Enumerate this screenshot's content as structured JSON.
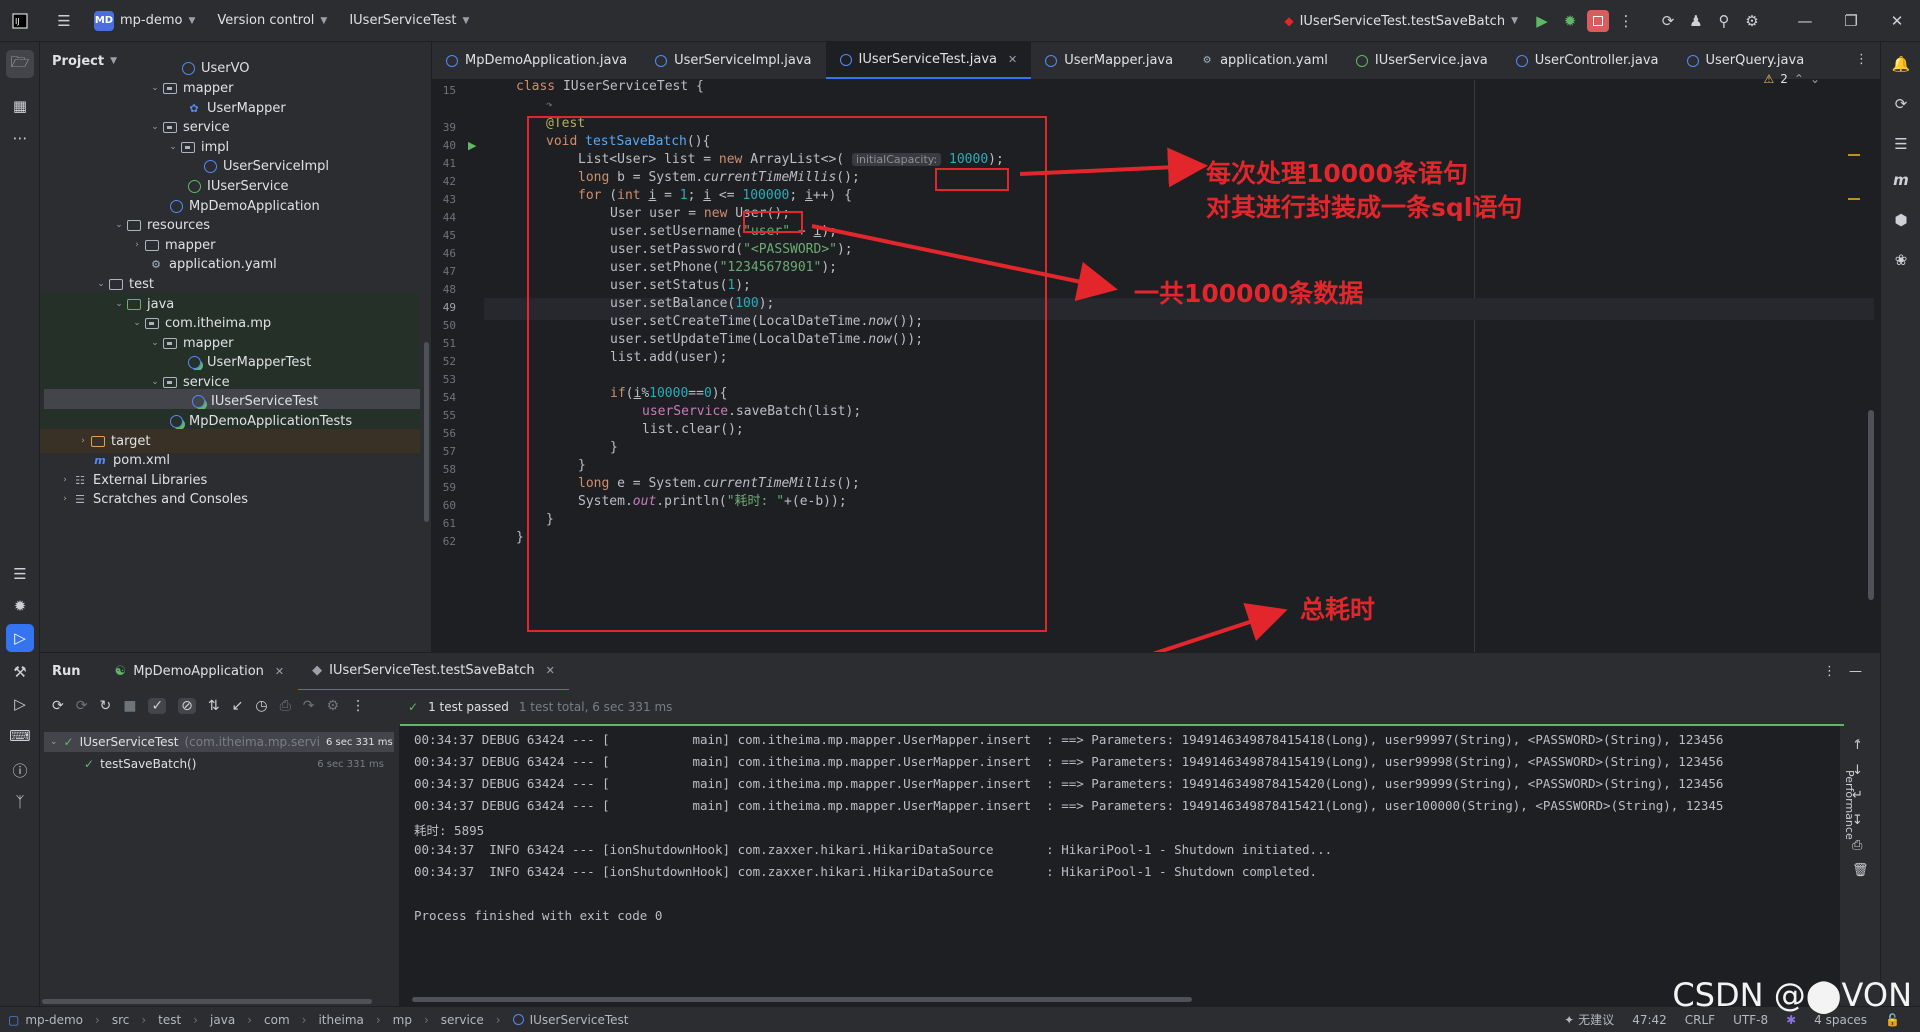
{
  "titlebar": {
    "project_badge": "MD",
    "project_name": "mp-demo",
    "vcs": "Version control",
    "file": "IUserServiceTest",
    "run_config": "IUserServiceTest.testSaveBatch"
  },
  "project_panel": {
    "title": "Project",
    "items": [
      {
        "label": "UserVO"
      },
      {
        "label": "mapper"
      },
      {
        "label": "UserMapper"
      },
      {
        "label": "service"
      },
      {
        "label": "impl"
      },
      {
        "label": "UserServiceImpl"
      },
      {
        "label": "IUserService"
      },
      {
        "label": "MpDemoApplication"
      },
      {
        "label": "resources"
      },
      {
        "label": "mapper"
      },
      {
        "label": "application.yaml"
      },
      {
        "label": "test"
      },
      {
        "label": "java"
      },
      {
        "label": "com.itheima.mp"
      },
      {
        "label": "mapper"
      },
      {
        "label": "UserMapperTest"
      },
      {
        "label": "service"
      },
      {
        "label": "IUserServiceTest"
      },
      {
        "label": "MpDemoApplicationTests"
      },
      {
        "label": "target"
      },
      {
        "label": "pom.xml"
      },
      {
        "label": "External Libraries"
      },
      {
        "label": "Scratches and Consoles"
      }
    ]
  },
  "tabs": [
    {
      "label": "MpDemoApplication.java"
    },
    {
      "label": "UserServiceImpl.java"
    },
    {
      "label": "IUserServiceTest.java"
    },
    {
      "label": "UserMapper.java"
    },
    {
      "label": "application.yaml"
    },
    {
      "label": "IUserService.java"
    },
    {
      "label": "UserController.java"
    },
    {
      "label": "UserQuery.java"
    }
  ],
  "editor": {
    "warnings": "2",
    "line_numbers": [
      "15",
      "39",
      "40",
      "41",
      "42",
      "43",
      "44",
      "45",
      "46",
      "47",
      "48",
      "49",
      "50",
      "51",
      "52",
      "53",
      "54",
      "55",
      "56",
      "57",
      "58",
      "59",
      "60",
      "61",
      "62"
    ],
    "class_decl": "class IUserServiceTest {",
    "inlay_hint": "initialCapacity:",
    "capacity": "10000",
    "loop_max": "100000",
    "code": {
      "l39": "@Test",
      "l40": "void testSaveBatch(){",
      "l42": "long b = System.currentTimeMillis();",
      "l44": "User user = new User();",
      "l45": "user.setUsername(\"user\" + i);",
      "l46": "user.setPassword(\"<PASSWORD>\");",
      "l47": "user.setPhone(\"12345678901\");",
      "l48": "user.setStatus(1);",
      "l49": "user.setBalance(100);",
      "l50": "user.setCreateTime(LocalDateTime.now());",
      "l51": "user.setUpdateTime(LocalDateTime.now());",
      "l52": "list.add(user);",
      "l54": "if(i%10000==0){",
      "l55": "userService.saveBatch(list);",
      "l56": "list.clear();",
      "l57": "}",
      "l58": "}",
      "l59": "long e = System.currentTimeMillis();",
      "l60": "System.out.println(\"耗时: \"+(e-b));",
      "l61": "}",
      "l62": "}"
    }
  },
  "annotations": {
    "batch_note_1": "每次处理10000条语句",
    "batch_note_2": "对其进行封装成一条sql语句",
    "total_note": "一共100000条数据",
    "time_note": "总耗时"
  },
  "run": {
    "title": "Run",
    "tabs": [
      "MpDemoApplication",
      "IUserServiceTest.testSaveBatch"
    ],
    "status": "1 test passed",
    "status_detail": "1 test total, 6 sec 331 ms",
    "tree": [
      {
        "label": "IUserServiceTest",
        "detail": "(com.itheima.mp.servi",
        "time": "6 sec 331 ms"
      },
      {
        "label": "testSaveBatch()",
        "time": "6 sec 331 ms"
      }
    ],
    "console": [
      "00:34:37 DEBUG 63424 --- [           main] com.itheima.mp.mapper.UserMapper.insert  : ==> Parameters: 1949146349878415418(Long), user99997(String), <PASSWORD>(String), 123456",
      "00:34:37 DEBUG 63424 --- [           main] com.itheima.mp.mapper.UserMapper.insert  : ==> Parameters: 1949146349878415419(Long), user99998(String), <PASSWORD>(String), 123456",
      "00:34:37 DEBUG 63424 --- [           main] com.itheima.mp.mapper.UserMapper.insert  : ==> Parameters: 1949146349878415420(Long), user99999(String), <PASSWORD>(String), 123456",
      "00:34:37 DEBUG 63424 --- [           main] com.itheima.mp.mapper.UserMapper.insert  : ==> Parameters: 1949146349878415421(Long), user100000(String), <PASSWORD>(String), 12345",
      "耗时: 5895",
      "00:34:37  INFO 63424 --- [ionShutdownHook] com.zaxxer.hikari.HikariDataSource       : HikariPool-1 - Shutdown initiated...",
      "00:34:37  INFO 63424 --- [ionShutdownHook] com.zaxxer.hikari.HikariDataSource       : HikariPool-1 - Shutdown completed.",
      "",
      "Process finished with exit code 0"
    ],
    "side_label": "Performance"
  },
  "statusbar": {
    "breadcrumb": [
      "mp-demo",
      "src",
      "test",
      "java",
      "com",
      "itheima",
      "mp",
      "service",
      "IUserServiceTest"
    ],
    "suggestion": "无建议",
    "position": "47:42",
    "line_sep": "CRLF",
    "encoding": "UTF-8",
    "indent": "4 spaces"
  },
  "watermark": "CSDN @⬤VON",
  "colors": {
    "annotation": "#e3262b",
    "accent": "#3574f0"
  }
}
